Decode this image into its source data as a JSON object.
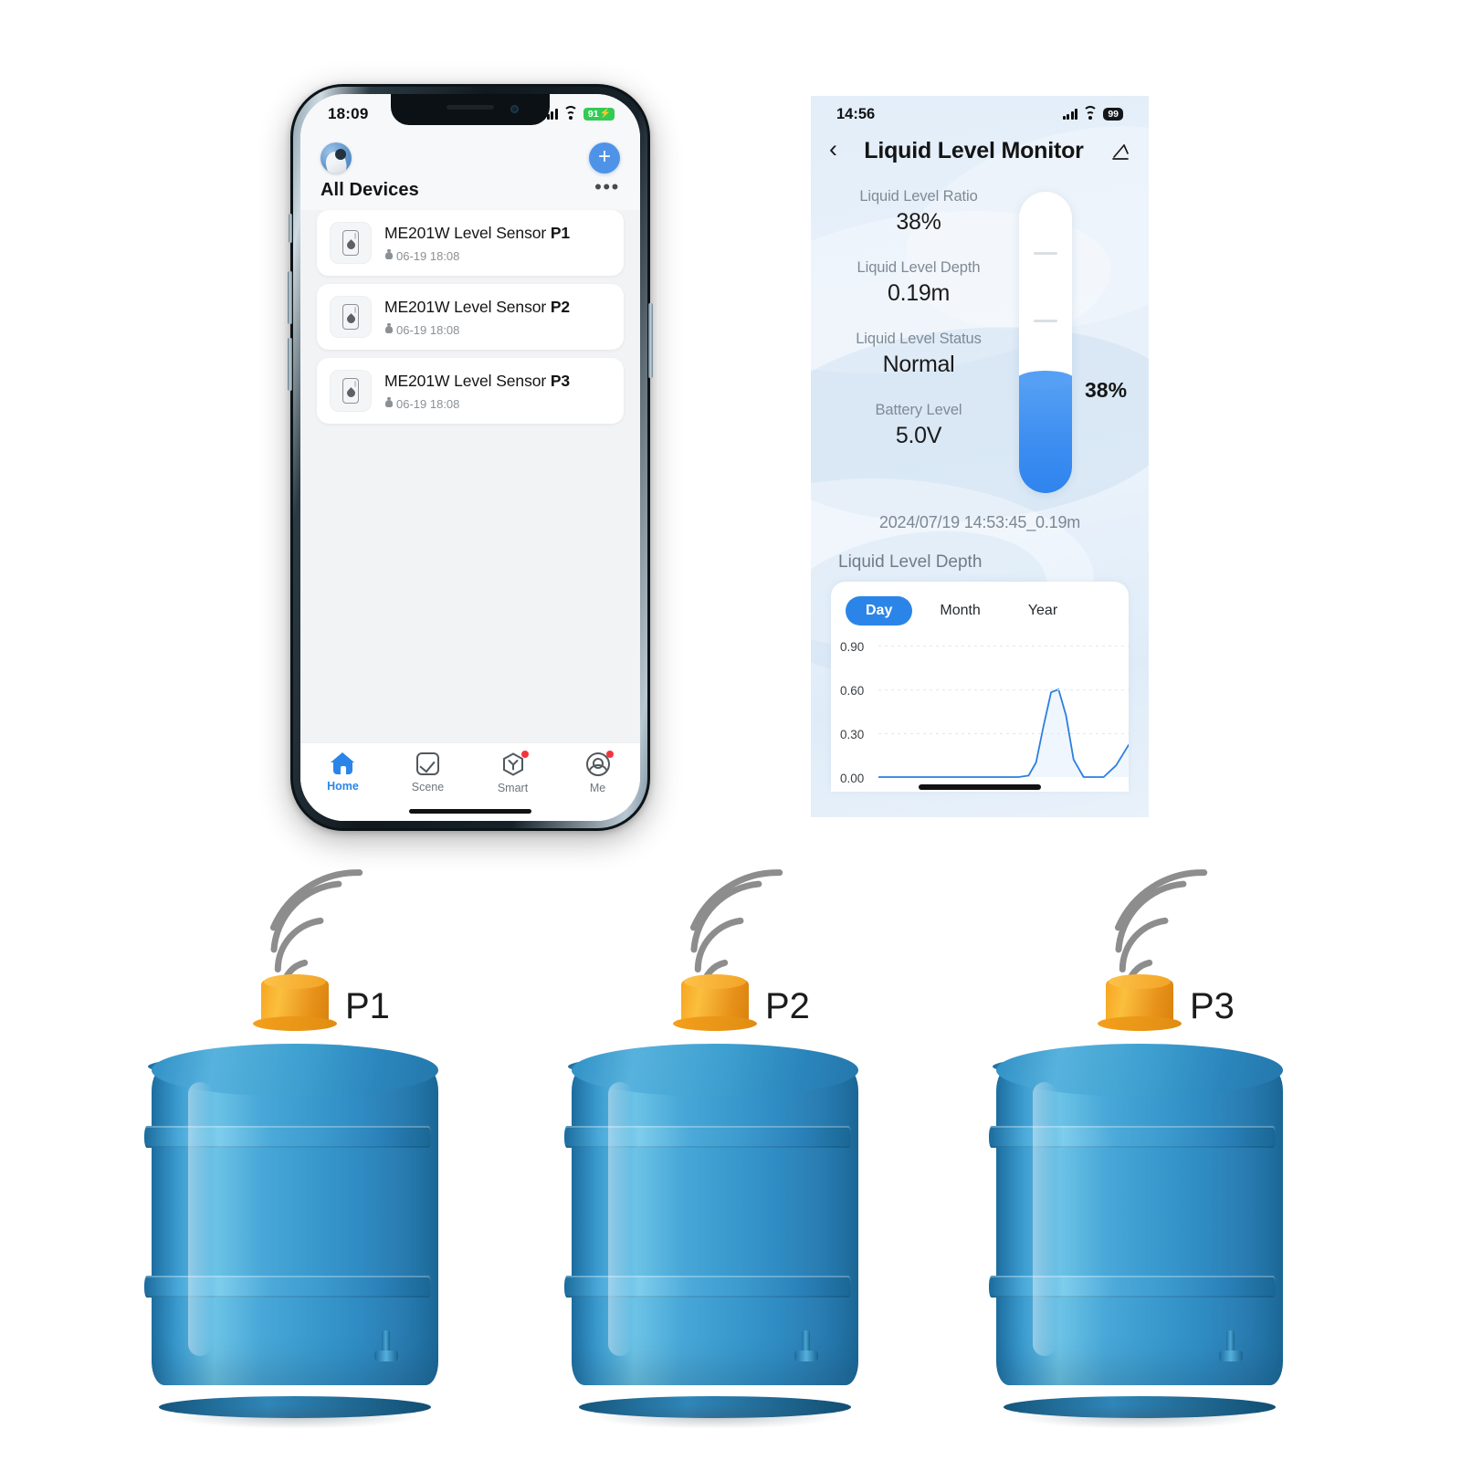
{
  "left_phone": {
    "status_bar": {
      "time": "18:09",
      "battery": "91",
      "charging_glyph": "⚡",
      "signal_icon": "cellular-signal-icon",
      "wifi_icon": "wifi-icon"
    },
    "header": {
      "avatar_icon": "user-avatar",
      "add_icon": "plus-icon",
      "title": "All Devices",
      "more_icon": "ellipsis-icon"
    },
    "devices": [
      {
        "name": "ME201W Level Sensor",
        "tag": "P1",
        "timestamp": "06-19 18:08",
        "icon": "level-sensor-icon",
        "alarm_icon": "bell-icon"
      },
      {
        "name": "ME201W Level Sensor",
        "tag": "P2",
        "timestamp": "06-19 18:08",
        "icon": "level-sensor-icon",
        "alarm_icon": "bell-icon"
      },
      {
        "name": "ME201W Level Sensor",
        "tag": "P3",
        "timestamp": "06-19 18:08",
        "icon": "level-sensor-icon",
        "alarm_icon": "bell-icon"
      }
    ],
    "tabs": [
      {
        "label": "Home",
        "icon": "home-icon",
        "active": true,
        "badge": false
      },
      {
        "label": "Scene",
        "icon": "checkbox-icon",
        "active": false,
        "badge": false
      },
      {
        "label": "Smart",
        "icon": "smart-hexagon-icon",
        "active": false,
        "badge": true
      },
      {
        "label": "Me",
        "icon": "account-icon",
        "active": false,
        "badge": true
      }
    ]
  },
  "right_phone": {
    "status_bar": {
      "time": "14:56",
      "battery": "99",
      "signal_icon": "cellular-signal-icon",
      "wifi_icon": "wifi-icon"
    },
    "header": {
      "back_icon": "chevron-left-icon",
      "title": "Liquid Level Monitor",
      "edit_icon": "pencil-edit-icon"
    },
    "metrics": [
      {
        "label": "Liquid Level Ratio",
        "value": "38%"
      },
      {
        "label": "Liquid Level Depth",
        "value": "0.19m"
      },
      {
        "label": "Liquid Level Status",
        "value": "Normal"
      },
      {
        "label": "Battery Level",
        "value": "5.0V"
      }
    ],
    "gauge": {
      "percent_label": "38%",
      "fill_percent": 38,
      "fill_color": "#3d8ef0",
      "tick_count": 3
    },
    "timestamp": "2024/07/19 14:53:45_0.19m",
    "chart_section_title": "Liquid Level Depth",
    "range_tabs": [
      {
        "label": "Day",
        "active": true
      },
      {
        "label": "Month",
        "active": false
      },
      {
        "label": "Year",
        "active": false
      }
    ]
  },
  "chart_data": {
    "type": "line",
    "title": "Liquid Level Depth",
    "xlabel": "",
    "ylabel": "",
    "ylim": [
      0.0,
      0.9
    ],
    "yticks": [
      "0.00",
      "0.30",
      "0.60",
      "0.90"
    ],
    "ytick_values": [
      0.0,
      0.3,
      0.6,
      0.9
    ],
    "grid": true,
    "legend": "none",
    "line_color": "#2b7fe0",
    "series": [
      {
        "name": "Liquid Level Depth",
        "x": [
          0,
          10,
          20,
          30,
          40,
          50,
          56,
          60,
          63,
          66,
          69,
          72,
          75,
          78,
          82,
          86,
          90,
          95,
          100
        ],
        "values": [
          0.0,
          0.0,
          0.0,
          0.0,
          0.0,
          0.0,
          0.0,
          0.01,
          0.1,
          0.35,
          0.58,
          0.6,
          0.42,
          0.12,
          0.0,
          0.0,
          0.0,
          0.08,
          0.22
        ]
      }
    ]
  },
  "tanks": [
    {
      "label": "P1",
      "signal_icon": "wireless-signal-waves-icon",
      "cap_color": "#f2a426",
      "body_color": "#3a9ace"
    },
    {
      "label": "P2",
      "signal_icon": "wireless-signal-waves-icon",
      "cap_color": "#f2a426",
      "body_color": "#3a9ace"
    },
    {
      "label": "P3",
      "signal_icon": "wireless-signal-waves-icon",
      "cap_color": "#f2a426",
      "body_color": "#3a9ace"
    }
  ]
}
